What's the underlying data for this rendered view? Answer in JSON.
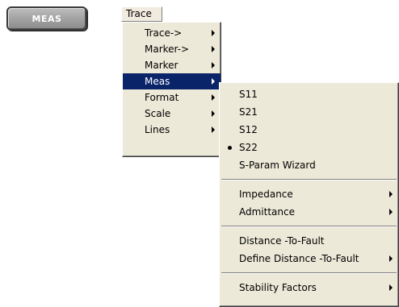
{
  "meas_button": {
    "label": "MEAS"
  },
  "menubar": {
    "trace_label": "Trace"
  },
  "trace_menu": {
    "items": [
      {
        "label": "Trace->"
      },
      {
        "label": "Marker->"
      },
      {
        "label": "Marker"
      },
      {
        "label": "Meas"
      },
      {
        "label": "Format"
      },
      {
        "label": "Scale"
      },
      {
        "label": "Lines"
      }
    ]
  },
  "meas_menu": {
    "groups": [
      {
        "items": [
          {
            "label": "S11"
          },
          {
            "label": "S21"
          },
          {
            "label": "S12"
          },
          {
            "label": "S22",
            "checked": true
          },
          {
            "label": "S-Param Wizard"
          }
        ]
      },
      {
        "items": [
          {
            "label": "Impedance"
          },
          {
            "label": "Admittance"
          }
        ]
      },
      {
        "items": [
          {
            "label": "Distance -To-Fault"
          },
          {
            "label": "Define Distance -To-Fault"
          }
        ]
      },
      {
        "items": [
          {
            "label": "Stability Factors"
          }
        ]
      }
    ]
  },
  "colors": {
    "menu_bg": "#ece9d8",
    "highlight": "#0a246a",
    "button_bg": "#a0a0a0"
  }
}
